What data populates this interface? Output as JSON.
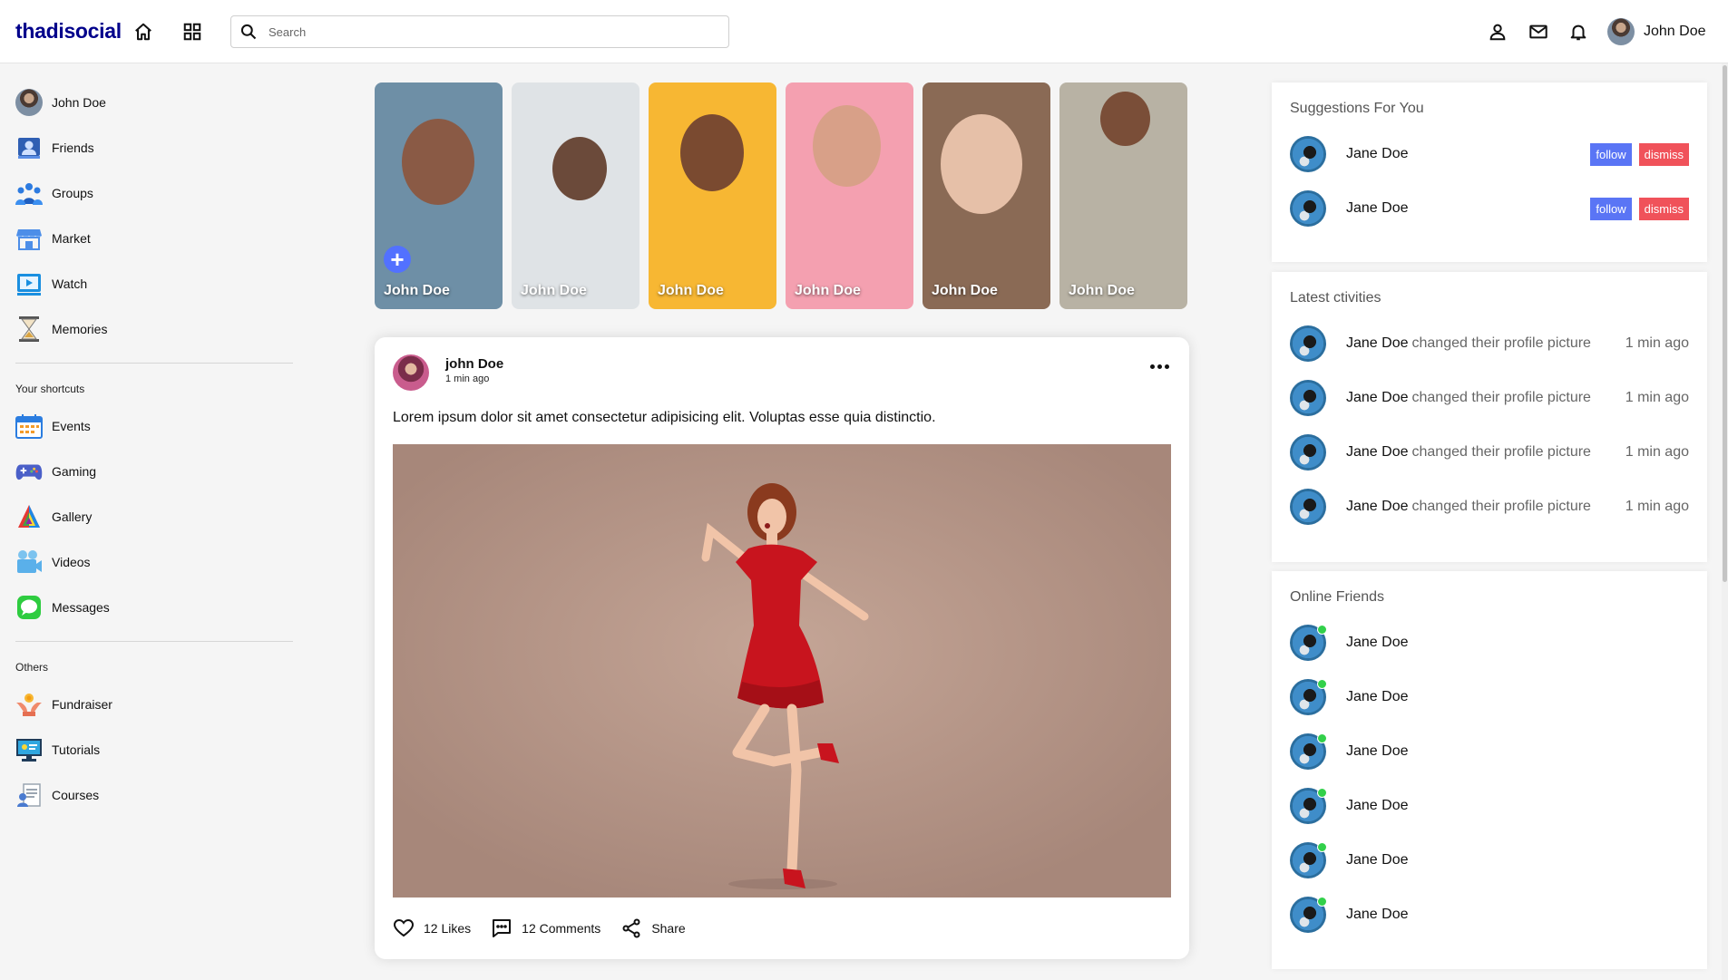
{
  "navbar": {
    "logo": "thadisocial",
    "search_placeholder": "Search",
    "user_name": "John Doe"
  },
  "sidebar": {
    "user": "John Doe",
    "main": [
      {
        "label": "Friends",
        "icon": "friends-icon"
      },
      {
        "label": "Groups",
        "icon": "groups-icon"
      },
      {
        "label": "Market",
        "icon": "market-icon"
      },
      {
        "label": "Watch",
        "icon": "watch-icon"
      },
      {
        "label": "Memories",
        "icon": "memories-icon"
      }
    ],
    "shortcuts_title": "Your shortcuts",
    "shortcuts": [
      {
        "label": "Events",
        "icon": "events-icon"
      },
      {
        "label": "Gaming",
        "icon": "gaming-icon"
      },
      {
        "label": "Gallery",
        "icon": "gallery-icon"
      },
      {
        "label": "Videos",
        "icon": "videos-icon"
      },
      {
        "label": "Messages",
        "icon": "messages-icon"
      }
    ],
    "others_title": "Others",
    "others": [
      {
        "label": "Fundraiser",
        "icon": "fundraiser-icon"
      },
      {
        "label": "Tutorials",
        "icon": "tutorials-icon"
      },
      {
        "label": "Courses",
        "icon": "courses-icon"
      }
    ]
  },
  "stories": [
    {
      "name": "John Doe",
      "bg": "#6e8fa6",
      "face": "#8a5a45"
    },
    {
      "name": "John Doe",
      "bg": "#dfe3e6",
      "face": "#6b4a3a"
    },
    {
      "name": "John Doe",
      "bg": "#f7b733",
      "face": "#7a4a30"
    },
    {
      "name": "John Doe",
      "bg": "#f4a0b0",
      "face": "#d8a088"
    },
    {
      "name": "John Doe",
      "bg": "#8a6a55",
      "face": "#e6c0a8"
    },
    {
      "name": "John Doe",
      "bg": "#b8b2a4",
      "face": "#7a4e38"
    }
  ],
  "post": {
    "author": "john Doe",
    "time": "1 min ago",
    "text": "Lorem ipsum dolor sit amet consectetur adipisicing elit. Voluptas esse quia distinctio.",
    "likes": "12 Likes",
    "comments": "12 Comments",
    "share": "Share"
  },
  "suggestions": {
    "title": "Suggestions For You",
    "items": [
      {
        "name": "Jane Doe",
        "follow": "follow",
        "dismiss": "dismiss"
      },
      {
        "name": "Jane Doe",
        "follow": "follow",
        "dismiss": "dismiss"
      }
    ]
  },
  "activities": {
    "title": "Latest ctivities",
    "items": [
      {
        "name": "Jane Doe",
        "action": "changed their profile picture",
        "time": "1 min ago"
      },
      {
        "name": "Jane Doe",
        "action": "changed their profile picture",
        "time": "1 min ago"
      },
      {
        "name": "Jane Doe",
        "action": "changed their profile picture",
        "time": "1 min ago"
      },
      {
        "name": "Jane Doe",
        "action": "changed their profile picture",
        "time": "1 min ago"
      }
    ]
  },
  "online": {
    "title": "Online Friends",
    "items": [
      {
        "name": "Jane Doe"
      },
      {
        "name": "Jane Doe"
      },
      {
        "name": "Jane Doe"
      },
      {
        "name": "Jane Doe"
      },
      {
        "name": "Jane Doe"
      },
      {
        "name": "Jane Doe"
      }
    ]
  },
  "colors": {
    "logo": "#00008b",
    "follow": "#5a75f5",
    "dismiss": "#f0525a",
    "online": "#32d04a"
  }
}
